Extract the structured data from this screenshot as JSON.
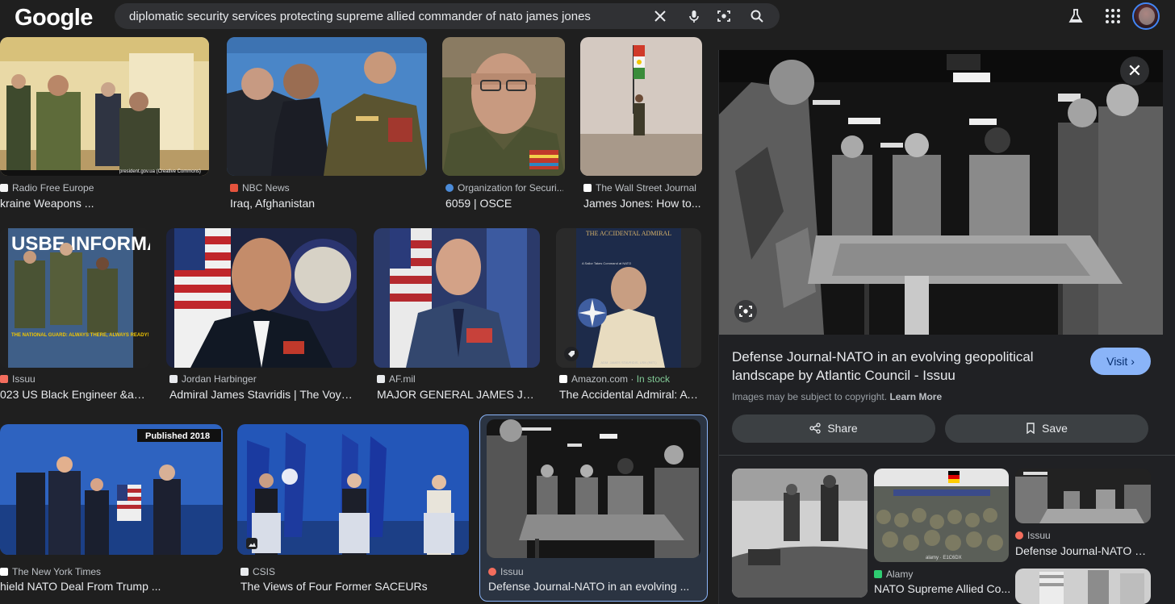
{
  "header": {
    "logo": "Google",
    "search_query": "diplomatic security services protecting supreme allied commander of nato james jones",
    "icons": [
      "close-icon",
      "microphone-icon",
      "lens-icon",
      "search-icon",
      "labs-flask-icon",
      "apps-grid-icon",
      "avatar"
    ]
  },
  "results": [
    {
      "source": "Radio Free Europe",
      "title": "kraine Weapons ..."
    },
    {
      "source": "NBC News",
      "title": "Iraq, Afghanistan"
    },
    {
      "source": "Organization for Securi...",
      "title": "6059 | OSCE"
    },
    {
      "source": "The Wall Street Journal",
      "title": "James Jones: How to..."
    },
    {
      "source": "Issuu",
      "title": "023 US Black Engineer &am..."
    },
    {
      "source": "Jordan Harbinger",
      "title": "Admiral James Stavridis | The Voya..."
    },
    {
      "source": "AF.mil",
      "title": "MAJOR GENERAL JAMES J. J..."
    },
    {
      "source": "Amazon.com",
      "source_extra": "In stock",
      "title": "The Accidental Admiral: A ..."
    },
    {
      "source": "The New York Times",
      "title": "hield NATO Deal From Trump ..."
    },
    {
      "source": "CSIS",
      "title": "The Views of Four Former SACEURs"
    },
    {
      "source": "Issuu",
      "title": "Defense Journal-NATO in an evolving ..."
    }
  ],
  "overlays": {
    "photo_credit": "president.gov.ua (Creative Commons)",
    "published_badge": "Published 2018",
    "book_title": "THE ACCIDENTAL ADMIRAL",
    "book_subtitle": "A Sailor Takes Command at NATO",
    "book_author": "ADM. JAMES STAVRIDIS, USN (RET.)",
    "magazine_title": "USBE INFORMATION TECHNOLOGY",
    "magazine_tag": "THE NATIONAL GUARD: ALWAYS THERE, ALWAYS READY!",
    "stock_photo_mark": "alamy · E1C6DX"
  },
  "panel": {
    "title": "Defense Journal-NATO in an evolving geopolitical landscape by Atlantic Council - Issuu",
    "visit_label": "Visit",
    "copyright_text": "Images may be subject to copyright.",
    "learn_more": "Learn More",
    "share_label": "Share",
    "save_label": "Save",
    "related": [
      {
        "source": "Alamy",
        "title": "NATO Supreme Allied Co..."
      },
      {
        "source": "Issuu",
        "title": "Defense Journal-NATO in..."
      }
    ]
  },
  "colors": {
    "background": "#1f1f1f",
    "search_bg": "#303134",
    "accent": "#8ab4f8",
    "in_stock": "#81c995"
  }
}
